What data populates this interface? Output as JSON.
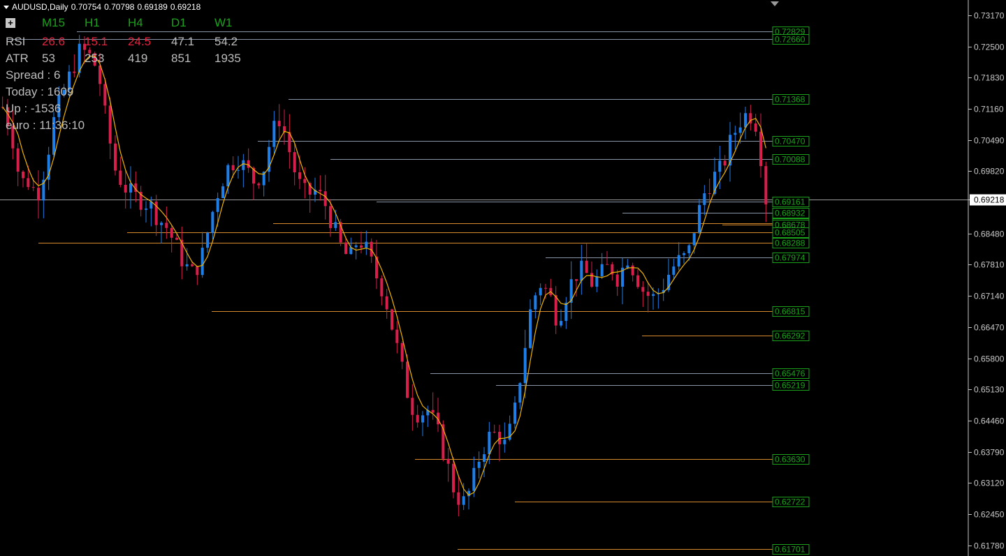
{
  "header": {
    "symbol": "AUDUSD,Daily",
    "open": "0.70754",
    "high": "0.70798",
    "low": "0.69189",
    "close": "0.69218"
  },
  "panel": {
    "plus": "+",
    "timeframes": [
      "M15",
      "H1",
      "H4",
      "D1",
      "W1"
    ],
    "rsi_label": "RSI",
    "rsi": [
      "26.6",
      "15.1",
      "24.5",
      "47.1",
      "54.2"
    ],
    "atr_label": "ATR",
    "atr": [
      "53",
      "253",
      "419",
      "851",
      "1935"
    ],
    "spread": "Spread : 6",
    "today": "Today : 1609",
    "up": "Up : -1536",
    "euro": "euro : 11:36:10"
  },
  "colors": {
    "bull": "#1e7ee8",
    "bear": "#d81e4b",
    "ma": "#f0b400",
    "level_gray": "#8a96a8",
    "level_orange": "#d98a2b",
    "label_green": "#1aa31a",
    "axis": "#c8c8c8"
  },
  "chart_data": {
    "type": "candlestick",
    "y_axis_ticks": [
      "0.73170",
      "0.72500",
      "0.71830",
      "0.71160",
      "0.70490",
      "0.69820",
      "0.69218",
      "0.68480",
      "0.67810",
      "0.67140",
      "0.66470",
      "0.65800",
      "0.65130",
      "0.64460",
      "0.63790",
      "0.63120",
      "0.62450",
      "0.61780"
    ],
    "current_price": "0.69218",
    "ylim": [
      0.6155,
      0.735
    ],
    "levels": [
      {
        "label": "0.72829",
        "value": 0.72829,
        "color": "gray",
        "start": 0.1
      },
      {
        "label": "0.72660",
        "value": 0.7266,
        "color": "gray",
        "start": 0.01
      },
      {
        "label": "0.71368",
        "value": 0.71368,
        "color": "gray",
        "start": 0.375
      },
      {
        "label": "0.70470",
        "value": 0.7047,
        "color": "gray",
        "start": 0.335
      },
      {
        "label": "0.70088",
        "value": 0.70088,
        "color": "gray",
        "start": 0.43
      },
      {
        "label": "0.69161",
        "value": 0.69161,
        "color": "gray",
        "start": 0.49
      },
      {
        "label": "0.68932",
        "value": 0.68932,
        "color": "gray",
        "start": 0.81
      },
      {
        "label": "0.68698",
        "value": 0.68698,
        "color": "orange",
        "start": 0.355
      },
      {
        "label": "0.68678",
        "value": 0.68678,
        "color": "orange",
        "start": 0.94
      },
      {
        "label": "0.68505",
        "value": 0.68505,
        "color": "orange",
        "start": 0.165
      },
      {
        "label": "0.68288",
        "value": 0.68288,
        "color": "orange",
        "start": 0.05
      },
      {
        "label": "0.67974",
        "value": 0.67974,
        "color": "gray",
        "start": 0.71
      },
      {
        "label": "0.66815",
        "value": 0.66815,
        "color": "orange",
        "start": 0.275
      },
      {
        "label": "0.66292",
        "value": 0.66292,
        "color": "orange",
        "start": 0.835
      },
      {
        "label": "0.65476",
        "value": 0.65476,
        "color": "gray",
        "start": 0.56
      },
      {
        "label": "0.65219",
        "value": 0.65219,
        "color": "gray",
        "start": 0.645
      },
      {
        "label": "0.63630",
        "value": 0.6363,
        "color": "orange",
        "start": 0.54
      },
      {
        "label": "0.62722",
        "value": 0.62722,
        "color": "orange",
        "start": 0.67
      },
      {
        "label": "0.61701",
        "value": 0.61701,
        "color": "orange",
        "start": 0.595
      }
    ],
    "price_path": [
      0.712,
      0.707,
      0.696,
      0.696,
      0.693,
      0.7,
      0.71,
      0.715,
      0.72,
      0.7245,
      0.723,
      0.72,
      0.708,
      0.6985,
      0.695,
      0.693,
      0.692,
      0.691,
      0.688,
      0.686,
      0.682,
      0.678,
      0.676,
      0.68,
      0.688,
      0.695,
      0.699,
      0.701,
      0.699,
      0.696,
      0.698,
      0.706,
      0.71,
      0.703,
      0.696,
      0.693,
      0.694,
      0.692,
      0.687,
      0.682,
      0.679,
      0.684,
      0.681,
      0.676,
      0.672,
      0.664,
      0.656,
      0.648,
      0.646,
      0.647,
      0.643,
      0.637,
      0.63,
      0.6265,
      0.63,
      0.637,
      0.641,
      0.642,
      0.639,
      0.646,
      0.658,
      0.67,
      0.674,
      0.672,
      0.666,
      0.672,
      0.676,
      0.677,
      0.674,
      0.676,
      0.678,
      0.675,
      0.68,
      0.676,
      0.672,
      0.671,
      0.673,
      0.677,
      0.679,
      0.68,
      0.688,
      0.694,
      0.697,
      0.699,
      0.705,
      0.709,
      0.711,
      0.708,
      0.6922
    ]
  }
}
